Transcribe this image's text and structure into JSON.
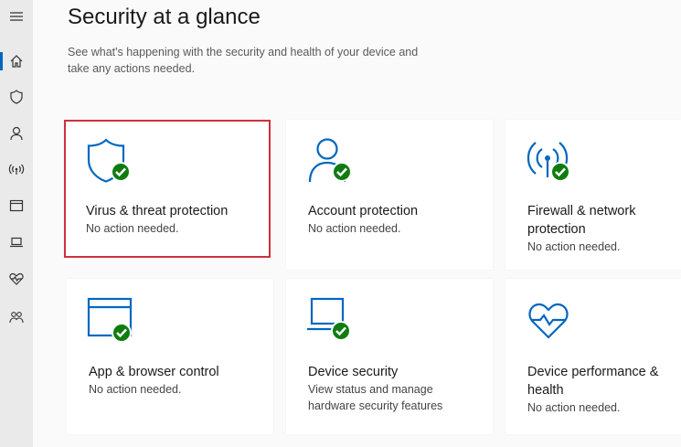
{
  "page": {
    "title": "Security at a glance",
    "subtitle": "See what's happening with the security and health of your device and take any actions needed."
  },
  "sidebar": {
    "items": [
      {
        "icon": "menu-icon"
      },
      {
        "icon": "home-icon",
        "active": true
      },
      {
        "icon": "shield-icon"
      },
      {
        "icon": "person-icon"
      },
      {
        "icon": "wireless-icon"
      },
      {
        "icon": "browser-icon"
      },
      {
        "icon": "laptop-icon"
      },
      {
        "icon": "heart-icon"
      },
      {
        "icon": "family-icon"
      }
    ]
  },
  "cards": [
    {
      "name": "Virus & threat protection",
      "status": "No action needed.",
      "icon": "shield-icon",
      "check": true
    },
    {
      "name": "Account protection",
      "status": "No action needed.",
      "icon": "person-icon",
      "check": true
    },
    {
      "name": "Firewall & network protection",
      "status": "No action needed.",
      "icon": "wireless-icon",
      "check": true
    },
    {
      "name": "App & browser control",
      "status": "No action needed.",
      "icon": "browser-icon",
      "check": true
    },
    {
      "name": "Device security",
      "status": "View status and manage hardware security features",
      "icon": "laptop-icon",
      "check": true
    },
    {
      "name": "Device performance & health",
      "status": "No action needed.",
      "icon": "heart-icon",
      "check": false
    }
  ],
  "colors": {
    "accent": "#0067c0",
    "ok_green": "#107c10",
    "selection_red": "#d0303f"
  }
}
